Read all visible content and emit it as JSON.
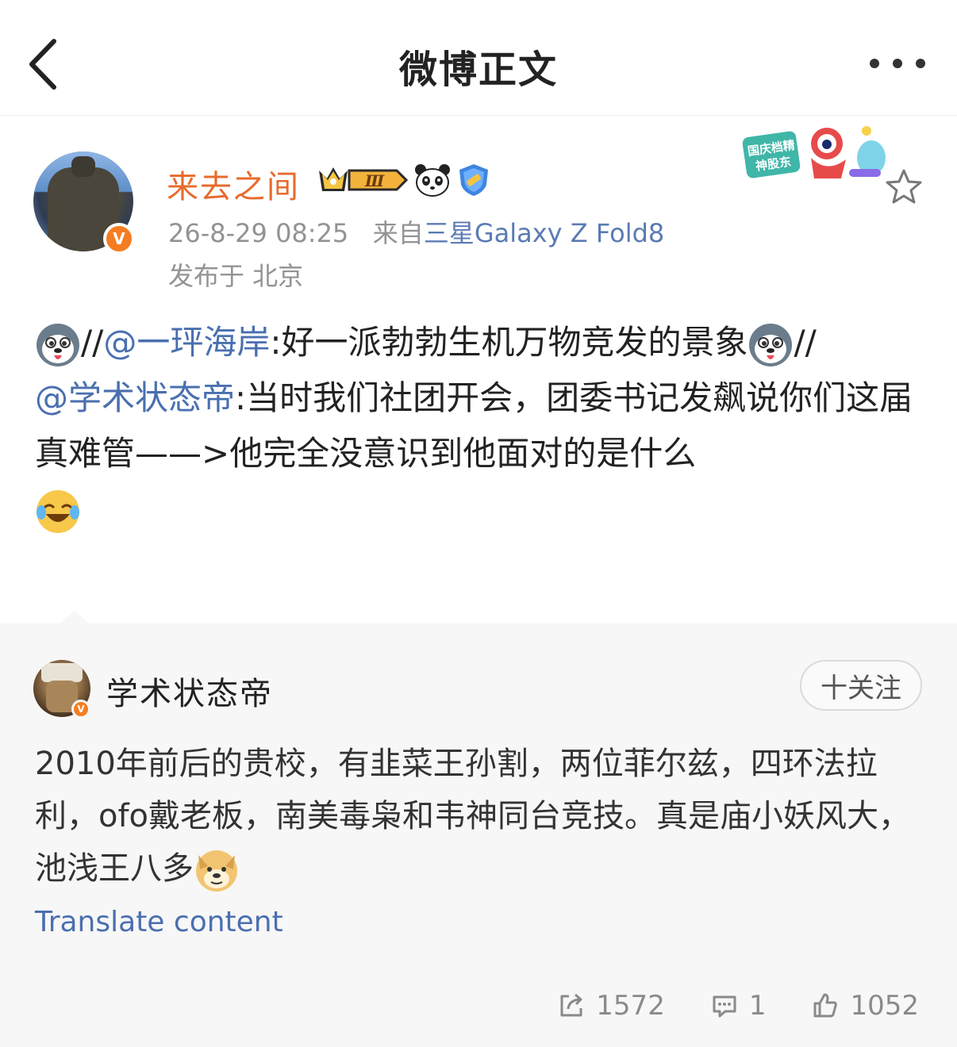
{
  "header": {
    "title": "微博正文"
  },
  "post": {
    "author": {
      "name": "来去之间",
      "vip_level": "Ⅲ"
    },
    "time": "26-8-29 08:25",
    "source_prefix": "来自",
    "source": "三星Galaxy Z Fold8",
    "location": "发布于 北京",
    "sticker_text": "国庆档精神股东",
    "text": {
      "seg1": "//",
      "mention1": "@一玶海岸",
      "seg2": ":好一派勃勃生机万物竞发的景象",
      "seg3": "//",
      "mention2": "@学术状态帝",
      "seg4": ":当时我们社团开会，团委书记发飙说你们这届真难管——>他完全没意识到他面对的是什么"
    }
  },
  "repost": {
    "author": {
      "name": "学术状态帝"
    },
    "follow_label": "十关注",
    "text": "2010年前后的贵校，有韭菜王孙割，两位菲尔兹，四环法拉利，ofo戴老板，南美毒枭和韦神同台竞技。真是庙小妖风大，池浅王八多",
    "translate_label": "Translate content",
    "stats": {
      "reposts": "1572",
      "comments": "1",
      "likes": "1052"
    }
  }
}
